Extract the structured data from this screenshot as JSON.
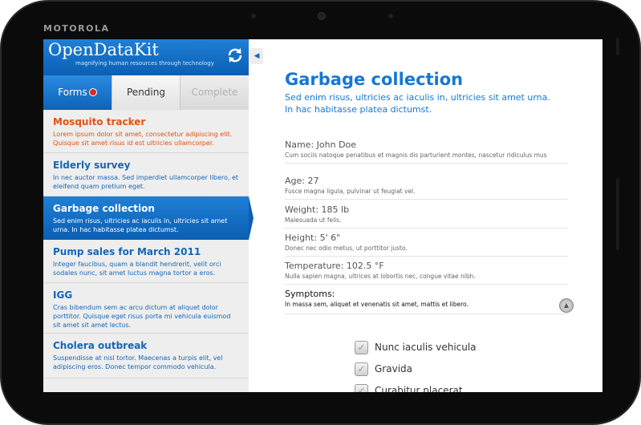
{
  "device": {
    "brand": "MOTOROLA"
  },
  "app": {
    "logo": "OpenDataKit",
    "tagline": "magnifying human resources through technology"
  },
  "tabs": [
    {
      "label": "Forms",
      "active": true,
      "alert": true
    },
    {
      "label": "Pending",
      "active": false
    },
    {
      "label": "Complete",
      "active": false,
      "disabled": true
    }
  ],
  "forms": [
    {
      "title": "Mosquito tracker",
      "desc": "Lorem ipsum dolor sit amet, consectetur adipiscing elit. Quisque sit amet risus id est ultricies ullamcorper.",
      "status": "alert"
    },
    {
      "title": "Elderly survey",
      "desc": "In nec auctor massa. Sed imperdiet ullamcorper libero, et eleifend quam pretium eget.",
      "status": "normal"
    },
    {
      "title": "Garbage collection",
      "desc": "Sed enim risus, ultricies ac iaculis in, ultricies sit amet urna. In hac habitasse platea dictumst.",
      "status": "selected"
    },
    {
      "title": "Pump sales for March 2011",
      "desc": "Integer faucibus, quam a blandit hendrerit, velit orci sodales nunc, sit amet luctus magna tortor a eros.",
      "status": "normal"
    },
    {
      "title": "IGG",
      "desc": "Cras bibendum sem ac arcu dictum at aliquet dolor porttitor. Quisque eget risus porta mi vehicula euismod sit amet sit amet lectus.",
      "status": "normal"
    },
    {
      "title": "Cholera outbreak",
      "desc": "Suspendisse at nisl tortor. Maecenas a turpis elit, vel adipiscing eros. Donec tempor commodo vehicula.",
      "status": "normal"
    }
  ],
  "detail": {
    "title": "Garbage collection",
    "subtitle": "Sed enim risus, ultricies ac iaculis in, ultricies sit amet urna. In hac habitasse platea dictumst.",
    "fields": [
      {
        "label": "Name: John Doe",
        "desc": "Cum sociis natoque penatibus et magnis dis parturient montes, nascetur ridiculus mus"
      },
      {
        "label": "Age: 27",
        "desc": "Fusce magna ligula, pulvinar ut feugiat vel."
      },
      {
        "label": "Weight: 185 lb",
        "desc": "Malesuada ut felis."
      },
      {
        "label": "Height: 5' 6\"",
        "desc": "Donec nec odio metus, ut porttitor justo."
      },
      {
        "label": "Temperature: 102.5 °F",
        "desc": "Nulla sapien magna, ultrices at lobortis nec, congue vitae nibh."
      },
      {
        "label": "Symptoms:",
        "desc": "In massa sem, aliquet et venenatis sit amet, mattis et libero."
      }
    ],
    "checkboxes": [
      {
        "label": "Nunc iaculis vehicula",
        "checked": true
      },
      {
        "label": "Gravida",
        "checked": true
      },
      {
        "label": "Curabitur placerat",
        "checked": true
      }
    ]
  },
  "colors": {
    "accent": "#1677d2",
    "alert": "#e05312",
    "header": "#0b5fb3"
  },
  "icons": {
    "refresh": "refresh-icon",
    "collapse": "collapse-arrow-icon",
    "expand": "expand-up-icon",
    "check": "check-icon"
  }
}
